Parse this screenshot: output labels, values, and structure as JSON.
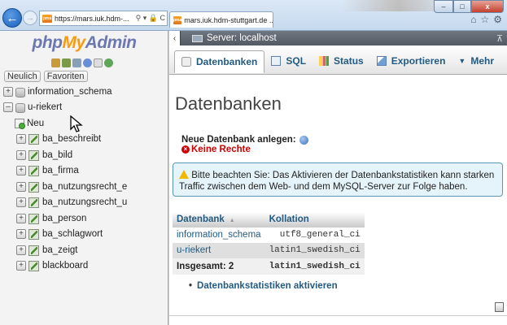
{
  "browser": {
    "url": "https://mars.iuk.hdm-...",
    "tab_title": "mars.iuk.hdm-stuttgart.de ...",
    "tab_close": "×",
    "window": {
      "minimize": "–",
      "maximize": "□",
      "close": "x"
    }
  },
  "nav": {
    "logo_php": "php",
    "logo_my": "My",
    "logo_admin": "Admin",
    "links": [
      "Neulich",
      "Favoriten"
    ],
    "tree": [
      {
        "label": "information_schema",
        "kind": "db",
        "expander": "+"
      },
      {
        "label": "u-riekert",
        "kind": "db",
        "expander": "–"
      },
      {
        "label": "Neu",
        "kind": "new"
      },
      {
        "label": "ba_beschreibt",
        "kind": "table",
        "expander": "+"
      },
      {
        "label": "ba_bild",
        "kind": "table",
        "expander": "+"
      },
      {
        "label": "ba_firma",
        "kind": "table",
        "expander": "+"
      },
      {
        "label": "ba_nutzungsrecht_e",
        "kind": "table",
        "expander": "+"
      },
      {
        "label": "ba_nutzungsrecht_u",
        "kind": "table",
        "expander": "+"
      },
      {
        "label": "ba_person",
        "kind": "table",
        "expander": "+"
      },
      {
        "label": "ba_schlagwort",
        "kind": "table",
        "expander": "+"
      },
      {
        "label": "ba_zeigt",
        "kind": "table",
        "expander": "+"
      },
      {
        "label": "blackboard",
        "kind": "table",
        "expander": "+"
      }
    ]
  },
  "server_bar": {
    "label": "Server: localhost"
  },
  "menu": {
    "tabs": [
      {
        "label": "Datenbanken",
        "icon": "database-icon",
        "active": true
      },
      {
        "label": "SQL",
        "icon": "sql-icon",
        "active": false
      },
      {
        "label": "Status",
        "icon": "status-icon",
        "active": false
      },
      {
        "label": "Exportieren",
        "icon": "export-icon",
        "active": false
      },
      {
        "label": "Mehr",
        "icon": "chevron-down-icon",
        "active": false
      }
    ]
  },
  "main": {
    "title": "Datenbanken",
    "create_label": "Neue Datenbank anlegen:",
    "no_rights": "Keine Rechte",
    "notice": "Bitte beachten Sie: Das Aktivieren der Datenbankstatistiken kann starken Traffic zwischen dem Web- und dem MySQL-Server zur Folge haben.",
    "table": {
      "headers": [
        "Datenbank",
        "Kollation"
      ],
      "rows": [
        {
          "db": "information_schema",
          "collation": "utf8_general_ci"
        },
        {
          "db": "u-riekert",
          "collation": "latin1_swedish_ci"
        }
      ],
      "total_label": "Insgesamt: 2",
      "total_collation": "latin1_swedish_ci"
    },
    "enable_stats": "Datenbankstatistiken aktivieren"
  },
  "colors": {
    "link": "#235a81",
    "error": "#cc0000",
    "notice_bg": "#e5f4fa",
    "logo_orange": "#f89c0e",
    "logo_blue": "#6c78af"
  }
}
